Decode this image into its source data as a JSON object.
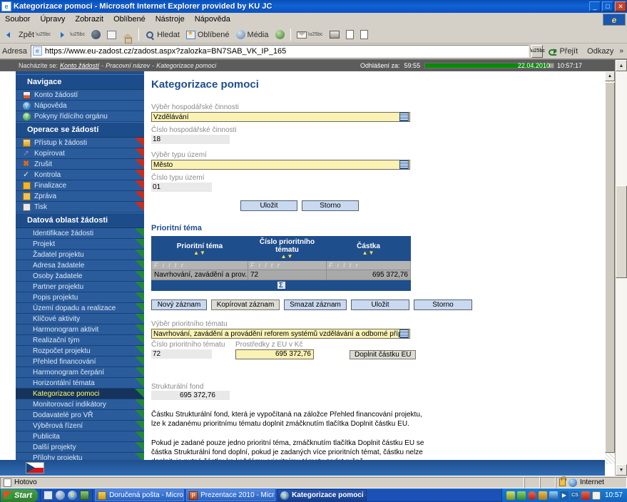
{
  "window": {
    "title": "Kategorizace pomoci - Microsoft Internet Explorer provided by KU JC",
    "minimize_label": "_",
    "maximize_label": "□",
    "close_label": "✕"
  },
  "menubar": {
    "items": [
      "Soubor",
      "Úpravy",
      "Zobrazit",
      "Oblíbené",
      "Nástroje",
      "Nápověda"
    ]
  },
  "toolbar": {
    "back": "Zpět",
    "forward": "",
    "search": "Hledat",
    "favorites": "Oblíbené",
    "media": "Média"
  },
  "address": {
    "label": "Adresa",
    "url": "https://www.eu-zadost.cz/zadost.aspx?zalozka=BN7SAB_VK_IP_165",
    "go_label": "Přejít",
    "links_label": "Odkazy",
    "chevron": "»"
  },
  "page_topbar": {
    "breadcrumb_prefix": "Nacházíte se:",
    "breadcrumb_link": "Konto žádostí",
    "breadcrumb_sep1": "-",
    "breadcrumb_mid": "Pracovní název",
    "breadcrumb_sep2": "-",
    "breadcrumb_current": "Kategorizace pomoci",
    "session_label": "Odhlášení za:",
    "session_time": "59:55",
    "date": "22.04.2010",
    "time": "10:57:17"
  },
  "sidebar": {
    "groups": [
      {
        "title": "Navigace",
        "items": [
          {
            "label": "Konto žádostí",
            "icon": "account-icon",
            "corner": "none"
          },
          {
            "label": "Nápověda",
            "icon": "help-blue-icon",
            "corner": "none"
          },
          {
            "label": "Pokyny řídícího orgánu",
            "icon": "help-green-icon",
            "corner": "none"
          }
        ]
      },
      {
        "title": "Operace se žádostí",
        "items": [
          {
            "label": "Přístup k žádosti",
            "icon": "users-icon",
            "corner": "red"
          },
          {
            "label": "Kopírovat",
            "icon": "copy-icon",
            "corner": "red"
          },
          {
            "label": "Zrušit",
            "icon": "cancel-icon",
            "corner": "red"
          },
          {
            "label": "Kontrola",
            "icon": "check-icon",
            "corner": "red"
          },
          {
            "label": "Finalizace",
            "icon": "lock-icon",
            "corner": "red"
          },
          {
            "label": "Zpráva",
            "icon": "message-icon",
            "corner": "red"
          },
          {
            "label": "Tisk",
            "icon": "print-icon",
            "corner": "red"
          }
        ]
      },
      {
        "title": "Datová oblast žádosti",
        "items": [
          {
            "label": "Identifikace žádosti",
            "corner": "green"
          },
          {
            "label": "Projekt",
            "corner": "green"
          },
          {
            "label": "Žadatel projektu",
            "corner": "green"
          },
          {
            "label": "Adresa žadatele",
            "corner": "green"
          },
          {
            "label": "Osoby žadatele",
            "corner": "green"
          },
          {
            "label": "Partner projektu",
            "corner": "green"
          },
          {
            "label": "Popis projektu",
            "corner": "green"
          },
          {
            "label": "Území dopadu a realizace",
            "corner": "green"
          },
          {
            "label": "Klíčové aktivity",
            "corner": "green"
          },
          {
            "label": "Harmonogram aktivit",
            "corner": "green"
          },
          {
            "label": "Realizační tým",
            "corner": "green"
          },
          {
            "label": "Rozpočet projektu",
            "corner": "green"
          },
          {
            "label": "Přehled financování",
            "corner": "green"
          },
          {
            "label": "Harmonogram čerpání",
            "corner": "green"
          },
          {
            "label": "Horizontální témata",
            "corner": "green"
          },
          {
            "label": "Kategorizace pomoci",
            "corner": "green",
            "active": true
          },
          {
            "label": "Monitorovací indikátory",
            "corner": "green"
          },
          {
            "label": "Dodavatelé pro VŘ",
            "corner": "green"
          },
          {
            "label": "Výběrová řízení",
            "corner": "green"
          },
          {
            "label": "Publicita",
            "corner": "green"
          },
          {
            "label": "Další projekty",
            "corner": "green"
          },
          {
            "label": "Přílohy projektu",
            "corner": "green"
          }
        ]
      }
    ]
  },
  "main": {
    "title": "Kategorizace pomoci",
    "economic_activity": {
      "label": "Výběr hospodářské činnosti",
      "value": "Vzdělávání"
    },
    "economic_activity_number": {
      "label": "Číslo hospodářské činnosti",
      "value": "18"
    },
    "territory_type": {
      "label": "Výběr typu území",
      "value": "Město"
    },
    "territory_type_number": {
      "label": "Číslo typu území",
      "value": "01"
    },
    "top_buttons": {
      "save": "Uložit",
      "cancel": "Storno"
    },
    "priority_theme_section": {
      "title": "Prioritní téma",
      "columns": [
        "Prioritní téma",
        "Číslo prioritního tématu",
        "Částka"
      ],
      "sort_arrows": "▲▼",
      "filter_placeholder": "F i l t r",
      "rows": [
        {
          "theme": "Navrhování, zavádění a prov...",
          "number": "72",
          "amount": "695 372,76"
        }
      ],
      "sum_icon": "Σ"
    },
    "grid_buttons": {
      "new": "Nový záznam",
      "copy": "Kopírovat záznam",
      "delete": "Smazat záznam",
      "save": "Uložit",
      "cancel": "Storno"
    },
    "priority_theme_select": {
      "label": "Výběr prioritního tématu",
      "value": "Navrhování, zavádění a provádění reforem systémů vzdělávání a odborné přípravy s cíler"
    },
    "priority_theme_number": {
      "label": "Číslo prioritního tématu",
      "value": "72"
    },
    "eu_funds": {
      "label": "Prostředky z EU v Kč",
      "value": "695 372,76"
    },
    "fill_eu_button": "Doplnit částku EU",
    "structural_fund": {
      "label": "Strukturální fond",
      "value": "695 372,76"
    },
    "notes": [
      "Částku Strukturální fond, která je vypočítaná na záložce Přehled financování projektu, lze k zadanému prioritnímu tématu doplnit zmáčknutím tlačítka Doplnit částku EU.",
      "Pokud je zadané pouze jedno prioritní téma, zmáčknutím tlačítka Doplnit částku EU se částka Strukturální fond doplní, pokud je zadaných více prioritních témat, částku nelze doplnit, je nutné částku ke každému prioritnímu tématu zadat ručně."
    ]
  },
  "statusbar": {
    "status": "Hotovo",
    "zone": "Internet"
  },
  "taskbar": {
    "start": "Start",
    "items": [
      {
        "label": "Doručená pošta - Microso...",
        "icon": "outlook-icon",
        "active": false
      },
      {
        "label": "Prezentace 2010 - Micros...",
        "icon": "powerpoint-icon",
        "active": false
      },
      {
        "label": "Kategorizace pomoci -...",
        "icon": "ie-icon",
        "active": true
      }
    ],
    "tray_time": "10:57"
  },
  "colors": {
    "brand_blue": "#1f4e8c",
    "sidebar_item": "#2a5c9c",
    "active_item_text": "#ffff66",
    "input_yellow": "#faf2b4",
    "grid_row": "#a9a9a9",
    "session_green": "#068c06"
  }
}
